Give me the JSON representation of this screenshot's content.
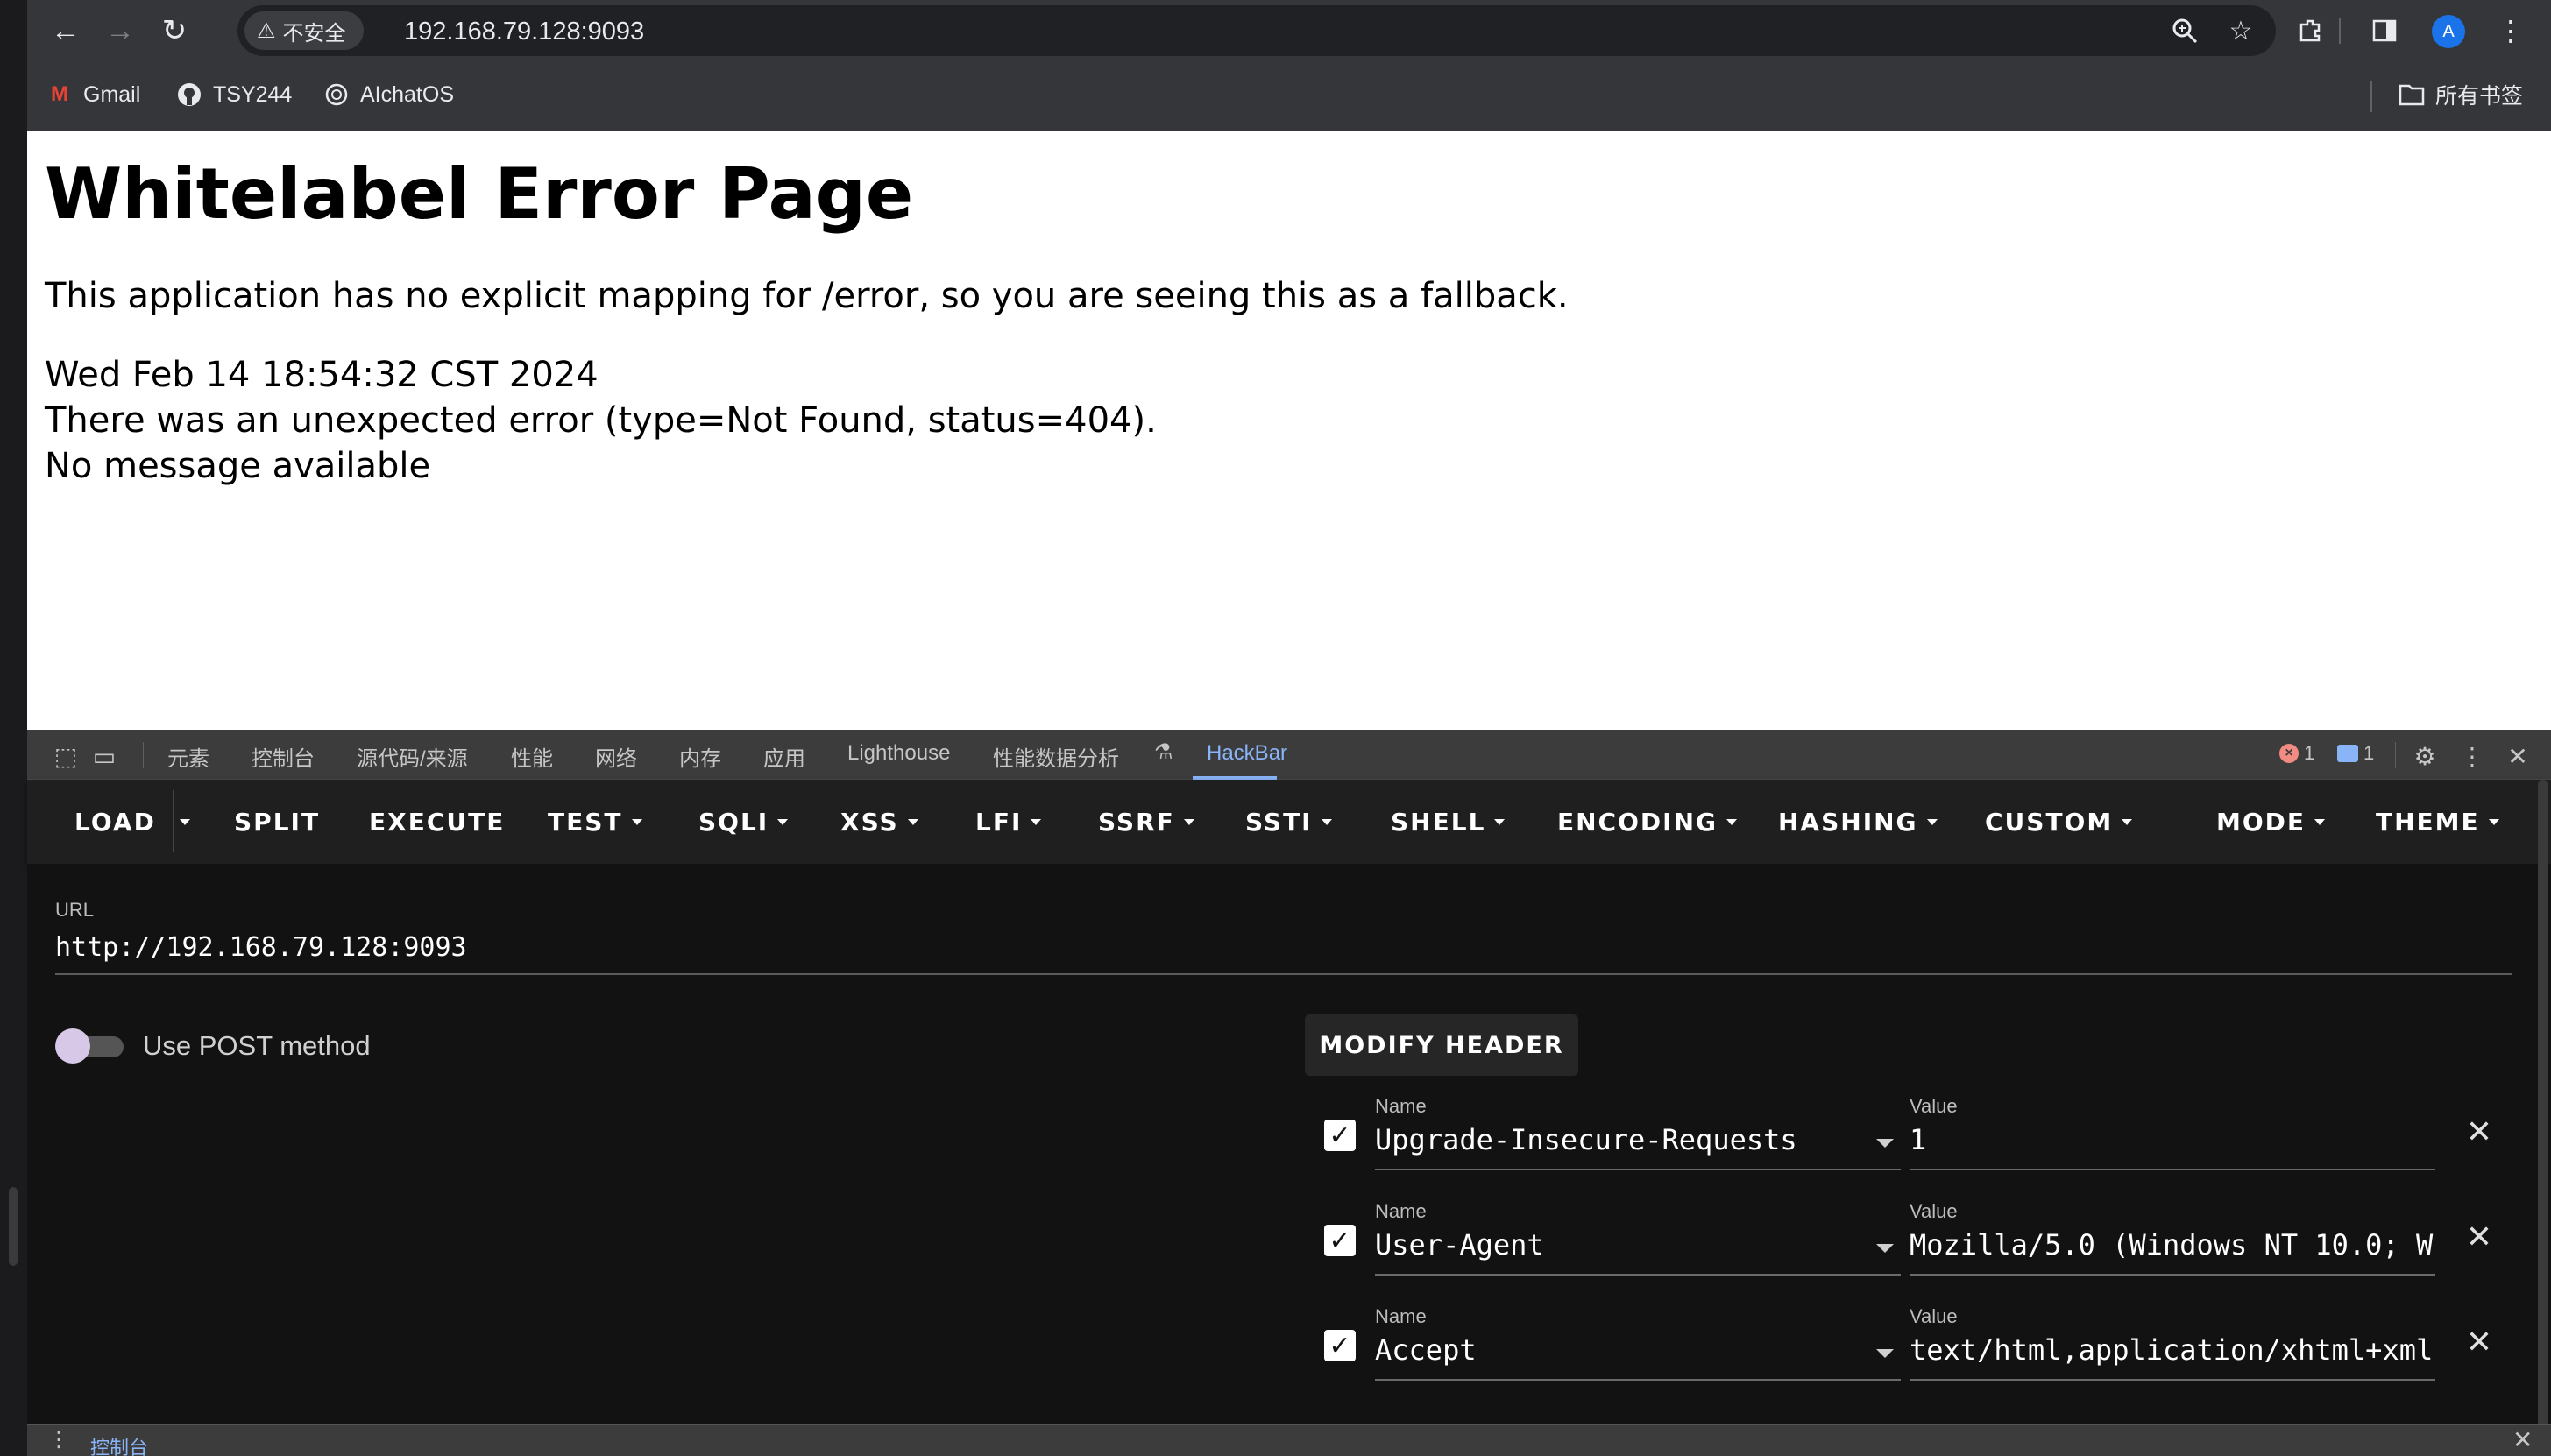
{
  "browser": {
    "security_label": "不安全",
    "address": "192.168.79.128:9093",
    "avatar_letter": "A",
    "bookmarks": [
      "Gmail",
      "TSY244",
      "AIchatOS"
    ],
    "all_bookmarks": "所有书签"
  },
  "page": {
    "title": "Whitelabel Error Page",
    "message": "This application has no explicit mapping for /error, so you are seeing this as a fallback.",
    "timestamp": "Wed Feb 14 18:54:32 CST 2024",
    "error": "There was an unexpected error (type=Not Found, status=404).",
    "detail": "No message available"
  },
  "devtools": {
    "tabs": [
      "元素",
      "控制台",
      "源代码/来源",
      "性能",
      "网络",
      "内存",
      "应用",
      "Lighthouse",
      "性能数据分析",
      "HackBar"
    ],
    "active_tab": "HackBar",
    "error_count": "1",
    "message_count": "1",
    "drawer_tab": "控制台"
  },
  "hackbar": {
    "menu": [
      "LOAD",
      "SPLIT",
      "EXECUTE",
      "TEST",
      "SQLI",
      "XSS",
      "LFI",
      "SSRF",
      "SSTI",
      "SHELL",
      "ENCODING",
      "HASHING",
      "CUSTOM",
      "MODE",
      "THEME"
    ],
    "url_label": "URL",
    "url_value": "http://192.168.79.128:9093",
    "post_label": "Use POST method",
    "post_enabled": false,
    "modify_header_label": "MODIFY HEADER",
    "name_label": "Name",
    "value_label": "Value",
    "headers": [
      {
        "name": "Upgrade-Insecure-Requests",
        "value": "1",
        "enabled": true
      },
      {
        "name": "User-Agent",
        "value": "Mozilla/5.0 (Windows NT 10.0; W",
        "enabled": true
      },
      {
        "name": "Accept",
        "value": "text/html,application/xhtml+xml",
        "enabled": true
      }
    ]
  },
  "colors": {
    "accent": "#8ab4f8",
    "devtools_bg": "#282828",
    "hackbar_bg": "#121212",
    "switch_thumb": "#d7c8e8"
  }
}
